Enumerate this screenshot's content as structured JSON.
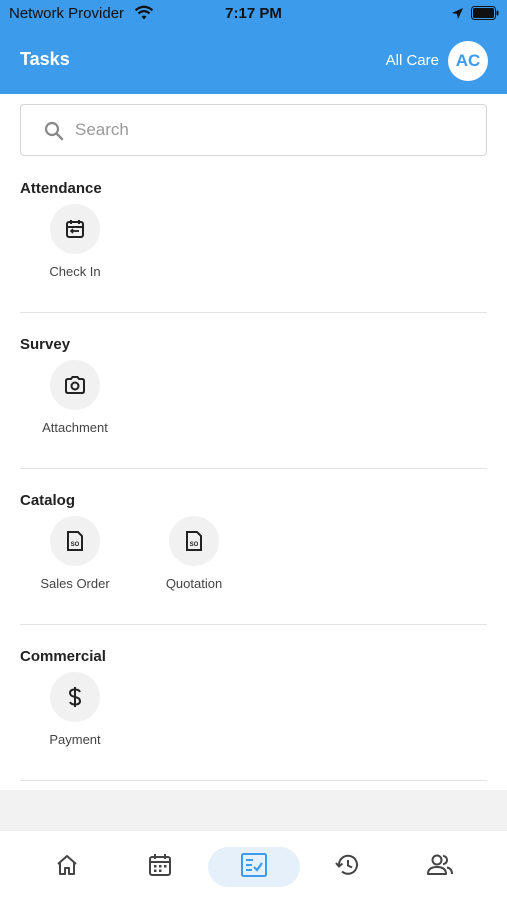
{
  "status_bar": {
    "carrier": "Network Provider",
    "time": "7:17 PM"
  },
  "header": {
    "title": "Tasks",
    "company": "All Care",
    "avatar_initials": "AC"
  },
  "search": {
    "placeholder": "Search",
    "value": ""
  },
  "sections": [
    {
      "heading": "Attendance",
      "items": [
        {
          "label": "Check In",
          "icon": "calendar-check-icon"
        }
      ]
    },
    {
      "heading": "Survey",
      "items": [
        {
          "label": "Attachment",
          "icon": "camera-icon"
        }
      ]
    },
    {
      "heading": "Catalog",
      "items": [
        {
          "label": "Sales Order",
          "icon": "document-so-icon"
        },
        {
          "label": "Quotation",
          "icon": "document-so-icon"
        }
      ]
    },
    {
      "heading": "Commercial",
      "items": [
        {
          "label": "Payment",
          "icon": "dollar-icon"
        }
      ]
    }
  ],
  "bottom_nav": {
    "items": [
      "home-icon",
      "calendar-icon",
      "tasks-icon",
      "history-icon",
      "contacts-icon"
    ],
    "active": "tasks-icon"
  },
  "colors": {
    "primary": "#3d9bec",
    "nav_active_bg": "#e5f0fb"
  }
}
